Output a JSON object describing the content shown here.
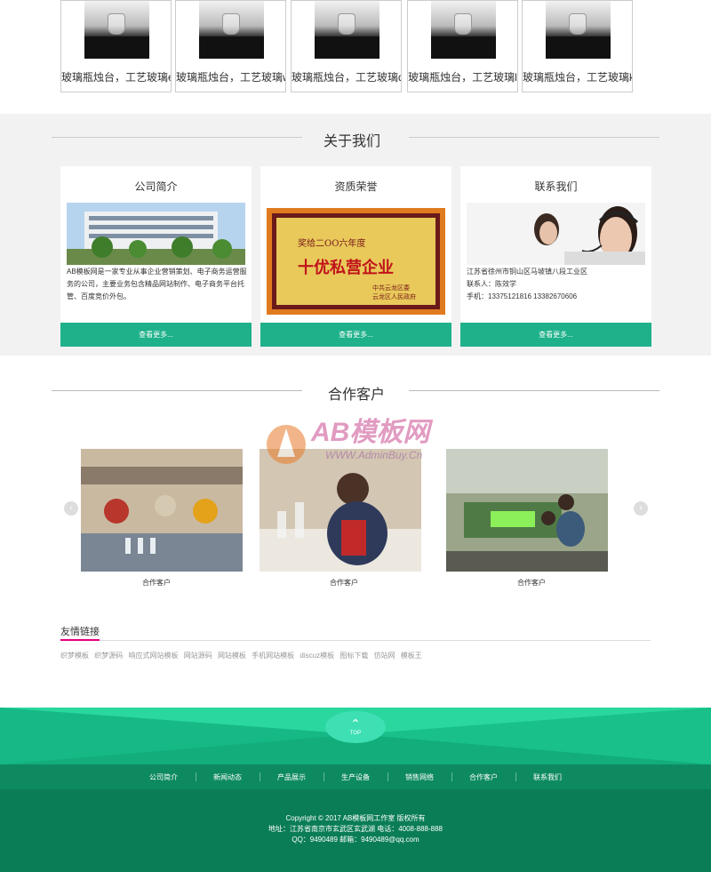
{
  "products": [
    {
      "name": "玻璃瓶烛台，工艺玻璃e"
    },
    {
      "name": "玻璃瓶烛台，工艺玻璃w"
    },
    {
      "name": "玻璃瓶烛台，工艺玻璃q"
    },
    {
      "name": "玻璃瓶烛台，工艺玻璃l"
    },
    {
      "name": "玻璃瓶烛台，工艺玻璃k"
    }
  ],
  "about": {
    "title": "关于我们",
    "cards": [
      {
        "title": "公司简介",
        "text": "AB模板网是一家专业从事企业营销策划、电子商务运营服务的公司，主要业务包含精品网站制作、电子商务平台托管、百度竞价外包。",
        "more": "查看更多..."
      },
      {
        "title": "资质荣誉",
        "more": "查看更多...",
        "cert": {
          "line1": "奖给二OO六年度",
          "line2": "十优私营企业",
          "sign1": "中共云龙区委",
          "sign2": "云龙区人民政府"
        }
      },
      {
        "title": "联系我们",
        "addr": "江苏省徐州市铜山区马坡镇八段工业区",
        "contact": "联系人：陈效学",
        "phone": "手机：13375121816 13382670606",
        "more": "查看更多..."
      }
    ]
  },
  "clients": {
    "title": "合作客户",
    "items": [
      {
        "caption": "合作客户"
      },
      {
        "caption": "合作客户"
      },
      {
        "caption": "合作客户"
      }
    ],
    "prev": "‹",
    "next": "›",
    "watermark": {
      "brand": "AB模板网",
      "url": "WWW.AdminBuy.Cn"
    }
  },
  "links": {
    "title": "友情链接",
    "items": [
      "织梦模板",
      "织梦源码",
      "响应式网站模板",
      "网站源码",
      "网站模板",
      "手机网站模板",
      "discuz模板",
      "图标下载",
      "仿站网",
      "模板王"
    ]
  },
  "footer": {
    "top_label": "TOP",
    "nav": [
      "公司简介",
      "新闻动态",
      "产品展示",
      "生产设备",
      "销售网络",
      "合作客户",
      "联系我们"
    ],
    "copyright": "Copyright © 2017 AB模板网工作室 版权所有",
    "address": "地址：江苏省南京市玄武区玄武湖 电话：4008-888-888",
    "qq": "QQ：9490489 邮箱：9490489@qq.com"
  },
  "colors": {
    "accent": "#1fb18a",
    "footer_dark": "#0a7d57",
    "footer_nav": "#0e8a61",
    "link_accent": "#e4007f"
  }
}
